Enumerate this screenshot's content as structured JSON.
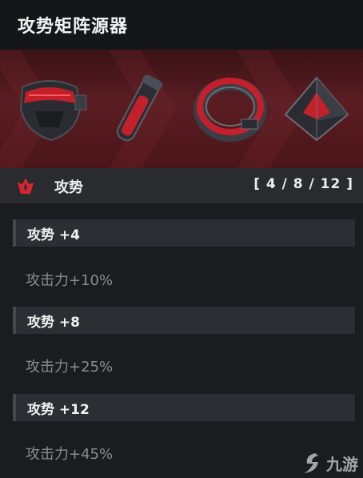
{
  "window": {
    "title": "攻势矩阵源器"
  },
  "banner": {
    "items": [
      {
        "name": "mask-item",
        "icon": "visor-mask-icon"
      },
      {
        "name": "tube-item",
        "icon": "capsule-tube-icon"
      },
      {
        "name": "ring-item",
        "icon": "ring-band-icon"
      },
      {
        "name": "pyramid-item",
        "icon": "pyramid-core-icon"
      }
    ],
    "accent": "#d8252f"
  },
  "set": {
    "name": "攻势",
    "count": "[ 4 / 8 / 12 ]",
    "icon": "flame-emblem-icon"
  },
  "tiers": [
    {
      "label": "攻势 +4",
      "bonus": "攻击力+10%"
    },
    {
      "label": "攻势 +8",
      "bonus": "攻击力+25%"
    },
    {
      "label": "攻势 +12",
      "bonus": "攻击力+45%"
    }
  ],
  "watermark": {
    "text": "九游"
  }
}
